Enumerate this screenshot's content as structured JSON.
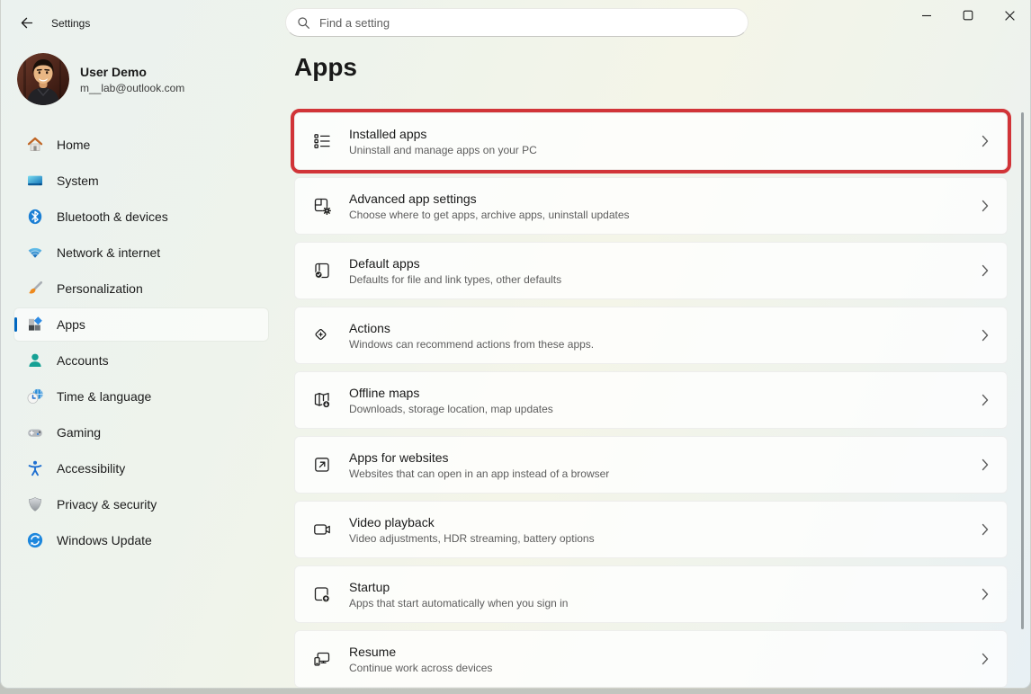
{
  "window": {
    "title": "Settings",
    "controls": {
      "minimize": "minimize",
      "maximize": "maximize",
      "close": "close"
    }
  },
  "search": {
    "placeholder": "Find a setting"
  },
  "user": {
    "name": "User Demo",
    "email": "m__lab@outlook.com"
  },
  "sidebar": {
    "items": [
      {
        "label": "Home",
        "icon": "home-icon",
        "selected": false
      },
      {
        "label": "System",
        "icon": "system-icon",
        "selected": false
      },
      {
        "label": "Bluetooth & devices",
        "icon": "bluetooth-icon",
        "selected": false
      },
      {
        "label": "Network & internet",
        "icon": "network-icon",
        "selected": false
      },
      {
        "label": "Personalization",
        "icon": "personalization-icon",
        "selected": false
      },
      {
        "label": "Apps",
        "icon": "apps-icon",
        "selected": true
      },
      {
        "label": "Accounts",
        "icon": "accounts-icon",
        "selected": false
      },
      {
        "label": "Time & language",
        "icon": "time-language-icon",
        "selected": false
      },
      {
        "label": "Gaming",
        "icon": "gaming-icon",
        "selected": false
      },
      {
        "label": "Accessibility",
        "icon": "accessibility-icon",
        "selected": false
      },
      {
        "label": "Privacy & security",
        "icon": "privacy-security-icon",
        "selected": false
      },
      {
        "label": "Windows Update",
        "icon": "windows-update-icon",
        "selected": false
      }
    ]
  },
  "main": {
    "title": "Apps",
    "items": [
      {
        "title": "Installed apps",
        "subtitle": "Uninstall and manage apps on your PC",
        "icon": "installed-apps-icon",
        "highlighted": true
      },
      {
        "title": "Advanced app settings",
        "subtitle": "Choose where to get apps, archive apps, uninstall updates",
        "icon": "advanced-app-settings-icon",
        "highlighted": false
      },
      {
        "title": "Default apps",
        "subtitle": "Defaults for file and link types, other defaults",
        "icon": "default-apps-icon",
        "highlighted": false
      },
      {
        "title": "Actions",
        "subtitle": "Windows can recommend actions from these apps.",
        "icon": "actions-icon",
        "highlighted": false
      },
      {
        "title": "Offline maps",
        "subtitle": "Downloads, storage location, map updates",
        "icon": "offline-maps-icon",
        "highlighted": false
      },
      {
        "title": "Apps for websites",
        "subtitle": "Websites that can open in an app instead of a browser",
        "icon": "apps-for-websites-icon",
        "highlighted": false
      },
      {
        "title": "Video playback",
        "subtitle": "Video adjustments, HDR streaming, battery options",
        "icon": "video-playback-icon",
        "highlighted": false
      },
      {
        "title": "Startup",
        "subtitle": "Apps that start automatically when you sign in",
        "icon": "startup-icon",
        "highlighted": false
      },
      {
        "title": "Resume",
        "subtitle": "Continue work across devices",
        "icon": "resume-icon",
        "highlighted": false
      }
    ]
  },
  "colors": {
    "accent": "#0067c0",
    "highlight_red": "#d13438",
    "text_primary": "#1a1a1a",
    "text_secondary": "#5d5d5d"
  }
}
